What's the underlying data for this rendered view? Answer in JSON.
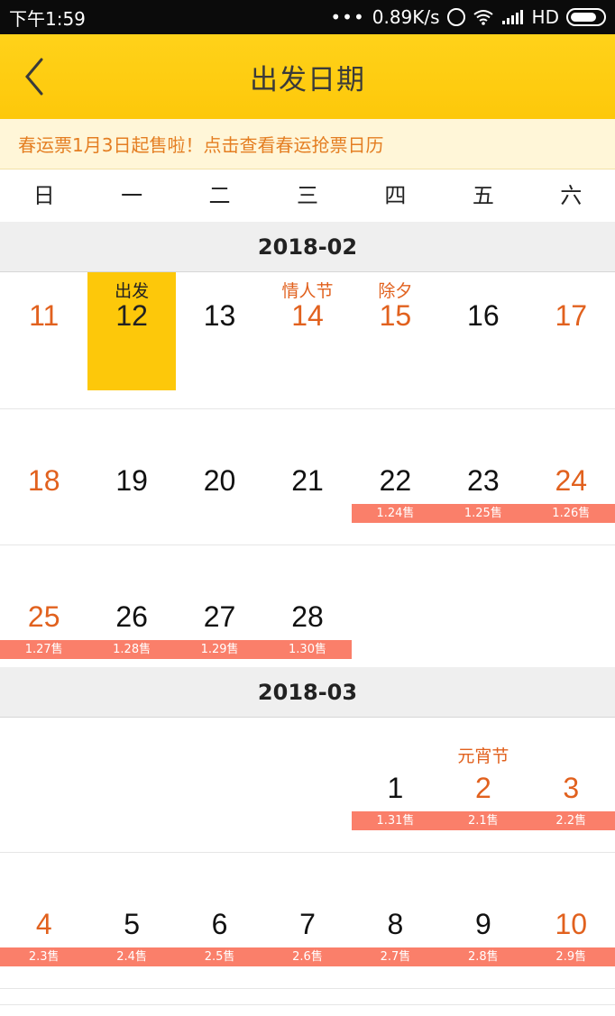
{
  "status_bar": {
    "time": "下午1:59",
    "network_speed": "0.89K/s",
    "network_type": "HD"
  },
  "header": {
    "title": "出发日期"
  },
  "notice": {
    "text": "春运票1月3日起售啦！点击查看春运抢票日历"
  },
  "weekdays": [
    "日",
    "一",
    "二",
    "三",
    "四",
    "五",
    "六"
  ],
  "months": [
    {
      "label": "2018-02",
      "weeks": [
        [
          {
            "day": "11",
            "label": "",
            "sale": "",
            "weekend": true
          },
          {
            "day": "12",
            "label": "出发",
            "sale": "",
            "selected": true
          },
          {
            "day": "13",
            "label": "",
            "sale": ""
          },
          {
            "day": "14",
            "label": "情人节",
            "sale": "",
            "holiday": true
          },
          {
            "day": "15",
            "label": "除夕",
            "sale": "",
            "holiday": true
          },
          {
            "day": "16",
            "label": "",
            "sale": ""
          },
          {
            "day": "17",
            "label": "",
            "sale": "",
            "weekend": true
          }
        ],
        [
          {
            "day": "18",
            "label": "",
            "sale": "",
            "weekend": true
          },
          {
            "day": "19",
            "label": "",
            "sale": ""
          },
          {
            "day": "20",
            "label": "",
            "sale": ""
          },
          {
            "day": "21",
            "label": "",
            "sale": ""
          },
          {
            "day": "22",
            "label": "",
            "sale": "1.24售"
          },
          {
            "day": "23",
            "label": "",
            "sale": "1.25售"
          },
          {
            "day": "24",
            "label": "",
            "sale": "1.26售",
            "weekend": true
          }
        ],
        [
          {
            "day": "25",
            "label": "",
            "sale": "1.27售",
            "weekend": true
          },
          {
            "day": "26",
            "label": "",
            "sale": "1.28售"
          },
          {
            "day": "27",
            "label": "",
            "sale": "1.29售"
          },
          {
            "day": "28",
            "label": "",
            "sale": "1.30售"
          }
        ]
      ]
    },
    {
      "label": "2018-03",
      "weeks": [
        [
          null,
          null,
          null,
          null,
          {
            "day": "1",
            "label": "",
            "sale": "1.31售"
          },
          {
            "day": "2",
            "label": "元宵节",
            "sale": "2.1售",
            "holiday": true
          },
          {
            "day": "3",
            "label": "",
            "sale": "2.2售",
            "weekend": true
          }
        ],
        [
          {
            "day": "4",
            "label": "",
            "sale": "2.3售",
            "weekend": true
          },
          {
            "day": "5",
            "label": "",
            "sale": "2.4售"
          },
          {
            "day": "6",
            "label": "",
            "sale": "2.5售"
          },
          {
            "day": "7",
            "label": "",
            "sale": "2.6售"
          },
          {
            "day": "8",
            "label": "",
            "sale": "2.7售"
          },
          {
            "day": "9",
            "label": "",
            "sale": "2.8售"
          },
          {
            "day": "10",
            "label": "",
            "sale": "2.9售",
            "weekend": true
          }
        ]
      ]
    }
  ],
  "colors": {
    "header_bg": "#fdc80a",
    "accent_orange": "#e1611e",
    "sale_bar": "#fa7f6a",
    "notice_text": "#e47e22"
  }
}
